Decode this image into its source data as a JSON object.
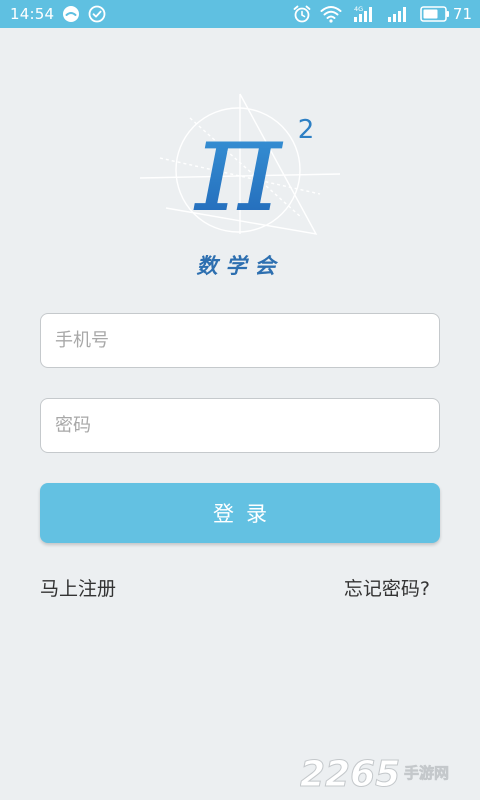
{
  "status_bar": {
    "time": "14:54",
    "battery": "71",
    "network": "4G"
  },
  "app": {
    "name": "数学会",
    "logo_symbol": "π",
    "logo_superscript": "2"
  },
  "form": {
    "phone_placeholder": "手机号",
    "password_placeholder": "密码",
    "login_label": "登录"
  },
  "links": {
    "register": "马上注册",
    "forgot_password": "忘记密码?"
  },
  "watermark": {
    "number": "2265",
    "text": "手游网"
  },
  "colors": {
    "status_bar": "#5fc0e1",
    "background": "#eceff1",
    "accent": "#63c1e2",
    "logo_blue": "#2d6fb0"
  },
  "icons": {
    "status_left": [
      "chat-bubble-icon",
      "check-circle-icon"
    ],
    "status_right": [
      "alarm-clock-icon",
      "wifi-icon",
      "cell-signal-icon",
      "battery-icon"
    ]
  }
}
